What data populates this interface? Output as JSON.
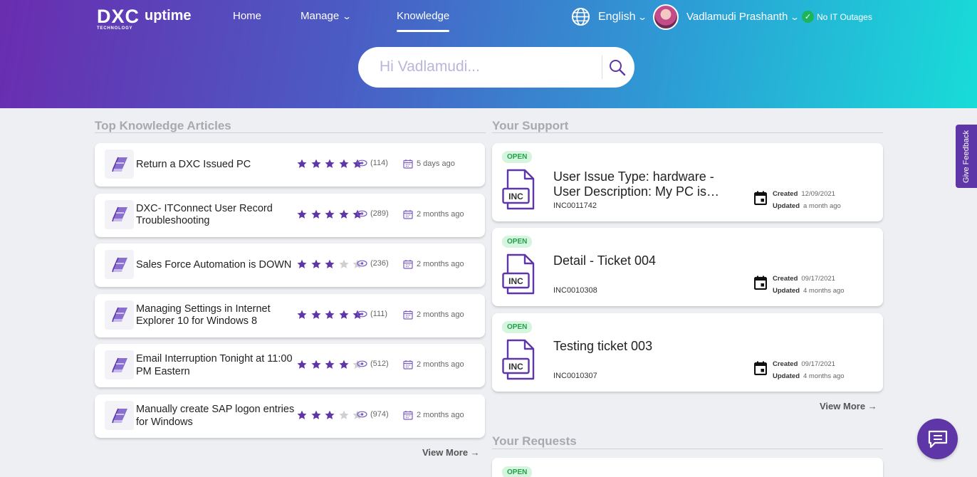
{
  "colors": {
    "accent": "#5e36a8",
    "open_badge_bg": "#d6f5de",
    "open_badge_text": "#1fa14a",
    "star_on": "#5e36a8",
    "star_off": "#cfcfd4"
  },
  "brand": {
    "logo_main": "DXC",
    "logo_sub": "TECHNOLOGY",
    "product": "uptime"
  },
  "nav": {
    "home": "Home",
    "manage": "Manage",
    "knowledge": "Knowledge",
    "active": "Knowledge"
  },
  "header": {
    "language": "English",
    "user_name": "Vadlamudi Prashanth",
    "status": "No IT Outages"
  },
  "search": {
    "placeholder": "Hi Vadlamudi..."
  },
  "knowledge": {
    "title": "Top Knowledge Articles",
    "view_more": "View More →",
    "articles": [
      {
        "title": "Return a DXC Issued PC",
        "rating": 5,
        "views": "(114)",
        "date": "5 days ago",
        "icon": "book-icon"
      },
      {
        "title": "DXC- ITConnect User Record Troubleshooting",
        "rating": 5,
        "views": "(289)",
        "date": "2 months ago",
        "icon": "book-icon"
      },
      {
        "title": "Sales Force Automation is DOWN",
        "rating": 3,
        "views": "(236)",
        "date": "2 months ago",
        "icon": "book-icon"
      },
      {
        "title": "Managing Settings in Internet Explorer 10 for Windows 8",
        "rating": 5,
        "views": "(111)",
        "date": "2 months ago",
        "icon": "book-icon"
      },
      {
        "title": "Email Interruption Tonight at 11:00 PM Eastern",
        "rating": 4,
        "views": "(512)",
        "date": "2 months ago",
        "icon": "book-icon"
      },
      {
        "title": "Manually create SAP logon entries for Windows",
        "rating": 3,
        "views": "(974)",
        "date": "2 months ago",
        "icon": "book-icon"
      }
    ]
  },
  "support": {
    "title": "Your Support",
    "view_more": "View More →",
    "created_label": "Created",
    "updated_label": "Updated",
    "tickets": [
      {
        "status": "OPEN",
        "type_icon": "INC",
        "title": "User Issue Type: hardware - User Description: My PC is…",
        "number": "INC0011742",
        "created": "12/09/2021",
        "updated": "a month ago"
      },
      {
        "status": "OPEN",
        "type_icon": "INC",
        "title": "Detail - Ticket 004",
        "number": "INC0010308",
        "created": "09/17/2021",
        "updated": "4 months ago"
      },
      {
        "status": "OPEN",
        "type_icon": "INC",
        "title": "Testing ticket 003",
        "number": "INC0010307",
        "created": "09/17/2021",
        "updated": "4 months ago"
      }
    ]
  },
  "requests": {
    "title": "Your Requests",
    "first_status": "OPEN"
  },
  "feedback": {
    "label": "Give Feedback"
  },
  "icons": {
    "globe": "globe-icon",
    "search": "search-icon",
    "chat": "chat-icon",
    "calendar": "calendar-icon",
    "eye": "eye-icon",
    "star": "star-icon",
    "document": "inc-document-icon",
    "check": "check-circle-icon"
  }
}
